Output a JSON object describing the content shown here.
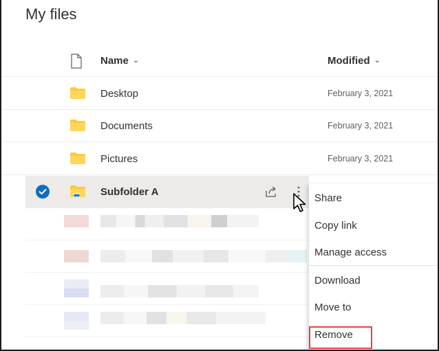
{
  "page": {
    "title": "My files"
  },
  "header": {
    "name_label": "Name",
    "modified_label": "Modified"
  },
  "rows": [
    {
      "name": "Desktop",
      "modified": "February 3, 2021"
    },
    {
      "name": "Documents",
      "modified": "February 3, 2021"
    },
    {
      "name": "Pictures",
      "modified": "February 3, 2021"
    },
    {
      "name": "Subfolder A",
      "modified": ""
    }
  ],
  "context_menu": {
    "items": [
      "Share",
      "Copy link",
      "Manage access",
      "Download",
      "Move to",
      "Remove"
    ]
  },
  "colors": {
    "accent": "#0f6cbd",
    "folder": "#ffc83d",
    "selected_row": "#edebe9",
    "highlight_box": "#e53e4b"
  },
  "icons": {
    "header_file": "file-icon",
    "folder": "folder-icon",
    "shared_folder": "shared-folder-icon",
    "check": "checkmark-circle-icon",
    "share": "share-icon",
    "more": "more-vertical-icon",
    "chevron": "chevron-down-icon",
    "cursor": "mouse-pointer-icon"
  }
}
